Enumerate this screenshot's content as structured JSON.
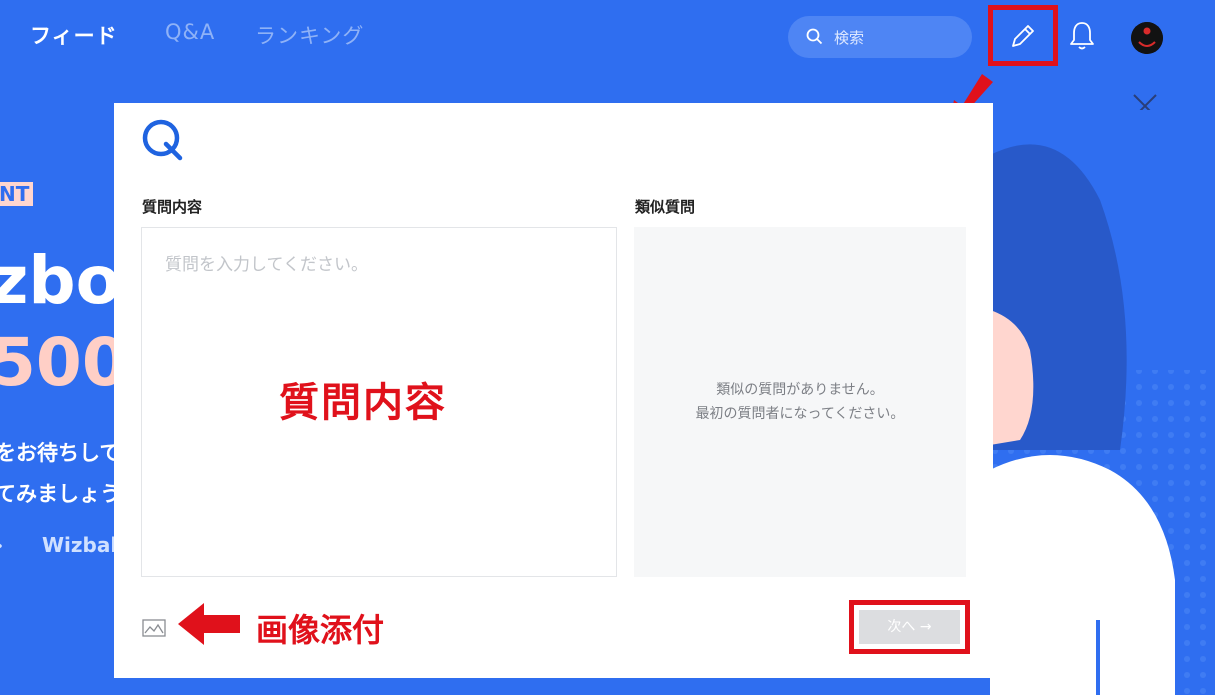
{
  "nav": {
    "tabs": [
      {
        "label": "フィード",
        "active": true
      },
      {
        "label": "Q&A",
        "active": false
      },
      {
        "label": "ランキング",
        "active": false
      }
    ],
    "search": {
      "placeholder": "検索",
      "icon": "search-icon"
    },
    "icons": [
      "pencil-icon",
      "bell-icon",
      "avatar"
    ]
  },
  "hero": {
    "badge": "NT",
    "line1": "zbo",
    "line2": "500",
    "sub1": "をお待ちして",
    "sub2": "てみましょう",
    "link_arrow": "›",
    "link_brand": "Wizbal"
  },
  "modal": {
    "logo": "Q",
    "content_label": "質問内容",
    "content_placeholder": "質問を入力してください。",
    "similar_label": "類似質問",
    "similar_empty_line1": "類似の質問がありません。",
    "similar_empty_line2": "最初の質問者になってください。",
    "next_button": "次へ →",
    "annotation_content": "質問内容",
    "annotation_attach": "画像添付"
  },
  "colors": {
    "background": "#2f6ef0",
    "annotation_red": "#e0111b",
    "logo_blue": "#1f63e0"
  }
}
